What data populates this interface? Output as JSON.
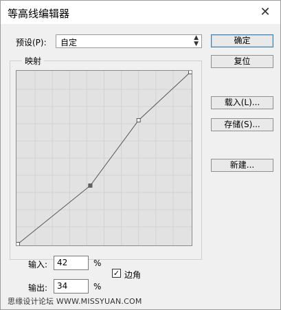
{
  "window": {
    "title": "等高线编辑器",
    "close_glyph": "✕"
  },
  "preset": {
    "label": "预设(P):",
    "value": "自定"
  },
  "buttons": {
    "ok": "确定",
    "reset": "复位",
    "load": "载入(L)...",
    "save": "存储(S)...",
    "new": "新建..."
  },
  "mapping": {
    "label": "映射",
    "points": [
      {
        "input": 0,
        "output": 0
      },
      {
        "input": 42,
        "output": 34
      },
      {
        "input": 70,
        "output": 72
      },
      {
        "input": 100,
        "output": 100
      }
    ]
  },
  "fields": {
    "input_label": "输入:",
    "input_value": "42",
    "input_unit": "%",
    "output_label": "输出:",
    "output_value": "34",
    "output_unit": "%"
  },
  "corner": {
    "label": "边角",
    "checked": true,
    "check_glyph": "✓"
  },
  "watermark": "思缘设计论坛 WWW.MISSYUAN.COM"
}
